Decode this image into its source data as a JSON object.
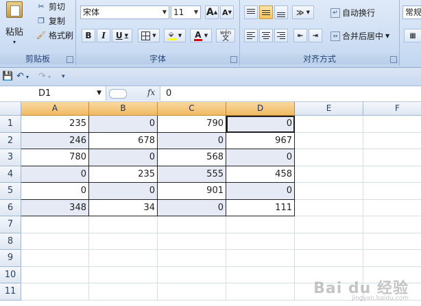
{
  "ribbon": {
    "clipboard": {
      "label": "剪贴板",
      "paste": "粘贴",
      "cut": "剪切",
      "copy": "复制",
      "format_painter": "格式刷"
    },
    "font": {
      "label": "字体",
      "font_name": "宋体",
      "font_size": "11",
      "grow": "A",
      "shrink": "A",
      "bold": "B",
      "italic": "I",
      "underline": "U",
      "font_color_glyph": "A",
      "phonetic": "wén"
    },
    "alignment": {
      "label": "对齐方式",
      "wrap_text": "自动换行",
      "merge_center": "合并后居中"
    },
    "number": {
      "format": "常规"
    }
  },
  "formula_bar": {
    "name_box": "D1",
    "fx": "fx",
    "value": "0"
  },
  "sheet": {
    "columns": [
      "A",
      "B",
      "C",
      "D",
      "E",
      "F"
    ],
    "rows": [
      "1",
      "2",
      "3",
      "4",
      "5",
      "6",
      "7",
      "8",
      "9",
      "10",
      "11"
    ],
    "data": [
      [
        "235",
        "0",
        "790",
        "0"
      ],
      [
        "246",
        "678",
        "0",
        "967"
      ],
      [
        "780",
        "0",
        "568",
        "0"
      ],
      [
        "0",
        "235",
        "555",
        "458"
      ],
      [
        "0",
        "0",
        "901",
        "0"
      ],
      [
        "348",
        "34",
        "0",
        "111"
      ]
    ],
    "selected_cell": "D1",
    "highlight_color": "#e6eaf5"
  },
  "watermark": {
    "main": "Bai du 经验",
    "sub": "jingyan.baidu.com"
  }
}
